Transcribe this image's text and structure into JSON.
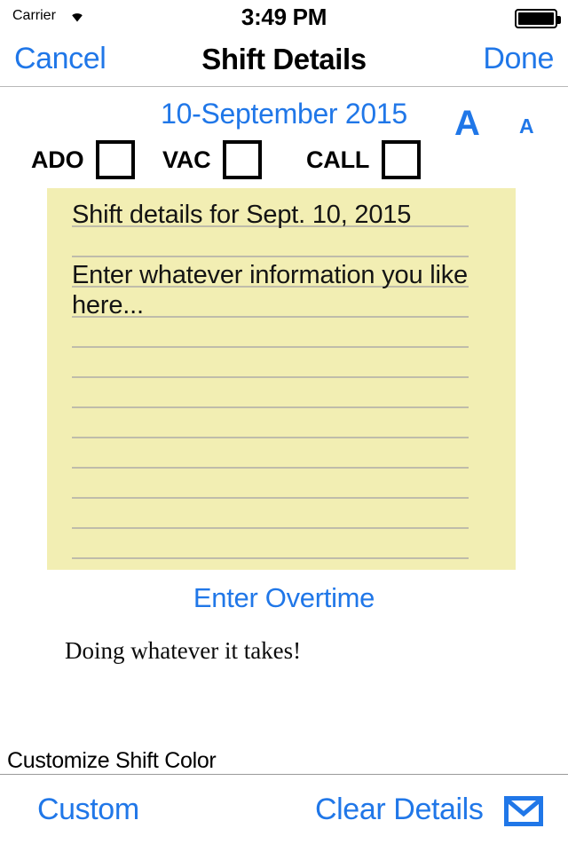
{
  "status_bar": {
    "carrier": "Carrier",
    "wifi_icon": "wifi-icon",
    "time": "3:49 PM",
    "battery_icon": "battery-full-icon"
  },
  "nav_bar": {
    "cancel_label": "Cancel",
    "title": "Shift Details",
    "done_label": "Done"
  },
  "header": {
    "date": "10-September 2015",
    "font_bigger_label": "A",
    "font_smaller_label": "A"
  },
  "checkboxes": [
    {
      "label": "ADO",
      "checked": false
    },
    {
      "label": "VAC",
      "checked": false
    },
    {
      "label": "CALL",
      "checked": false
    }
  ],
  "notepad": {
    "lines": [
      "Shift details for Sept. 10, 2015",
      "",
      "Enter whatever information you like",
      "here...",
      "",
      "",
      "",
      "",
      "",
      "",
      "",
      ""
    ],
    "background_color": "#f2eeb3",
    "rule_color": "#bfbcaa"
  },
  "overtime": {
    "link_label": "Enter Overtime",
    "note": "Doing whatever it takes!"
  },
  "bottom": {
    "customize_label": "Customize Shift Color",
    "custom_button": "Custom",
    "clear_details_button": "Clear Details",
    "mail_icon": "envelope-icon"
  },
  "colors": {
    "tint_blue": "#2077e8",
    "notepad_yellow": "#f2eeb3",
    "text_black": "#000000"
  }
}
